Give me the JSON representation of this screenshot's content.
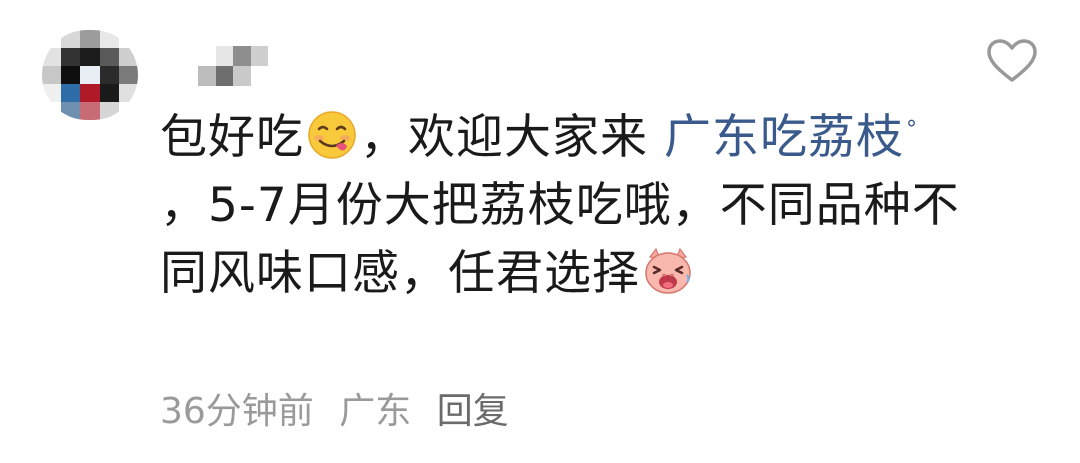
{
  "comment": {
    "text_part1": "包好吃",
    "text_part2": "，欢迎大家来 ",
    "link_text": "广东吃荔枝",
    "text_part3": "，5-7月份大把荔枝吃哦，不同品种不同风味口感，任君选择",
    "time": "36分钟前",
    "location": "广东",
    "reply_label": "回复"
  },
  "icons": {
    "like": "heart-outline-icon",
    "link_search": "search-icon",
    "emoji1": "yum-face-emoji",
    "emoji2": "laughing-pig-emoji"
  },
  "colors": {
    "text": "#1a1a1a",
    "link": "#3a5a8c",
    "meta": "#9a9a9a",
    "reply": "#6b6b6b",
    "heart": "#999999"
  }
}
